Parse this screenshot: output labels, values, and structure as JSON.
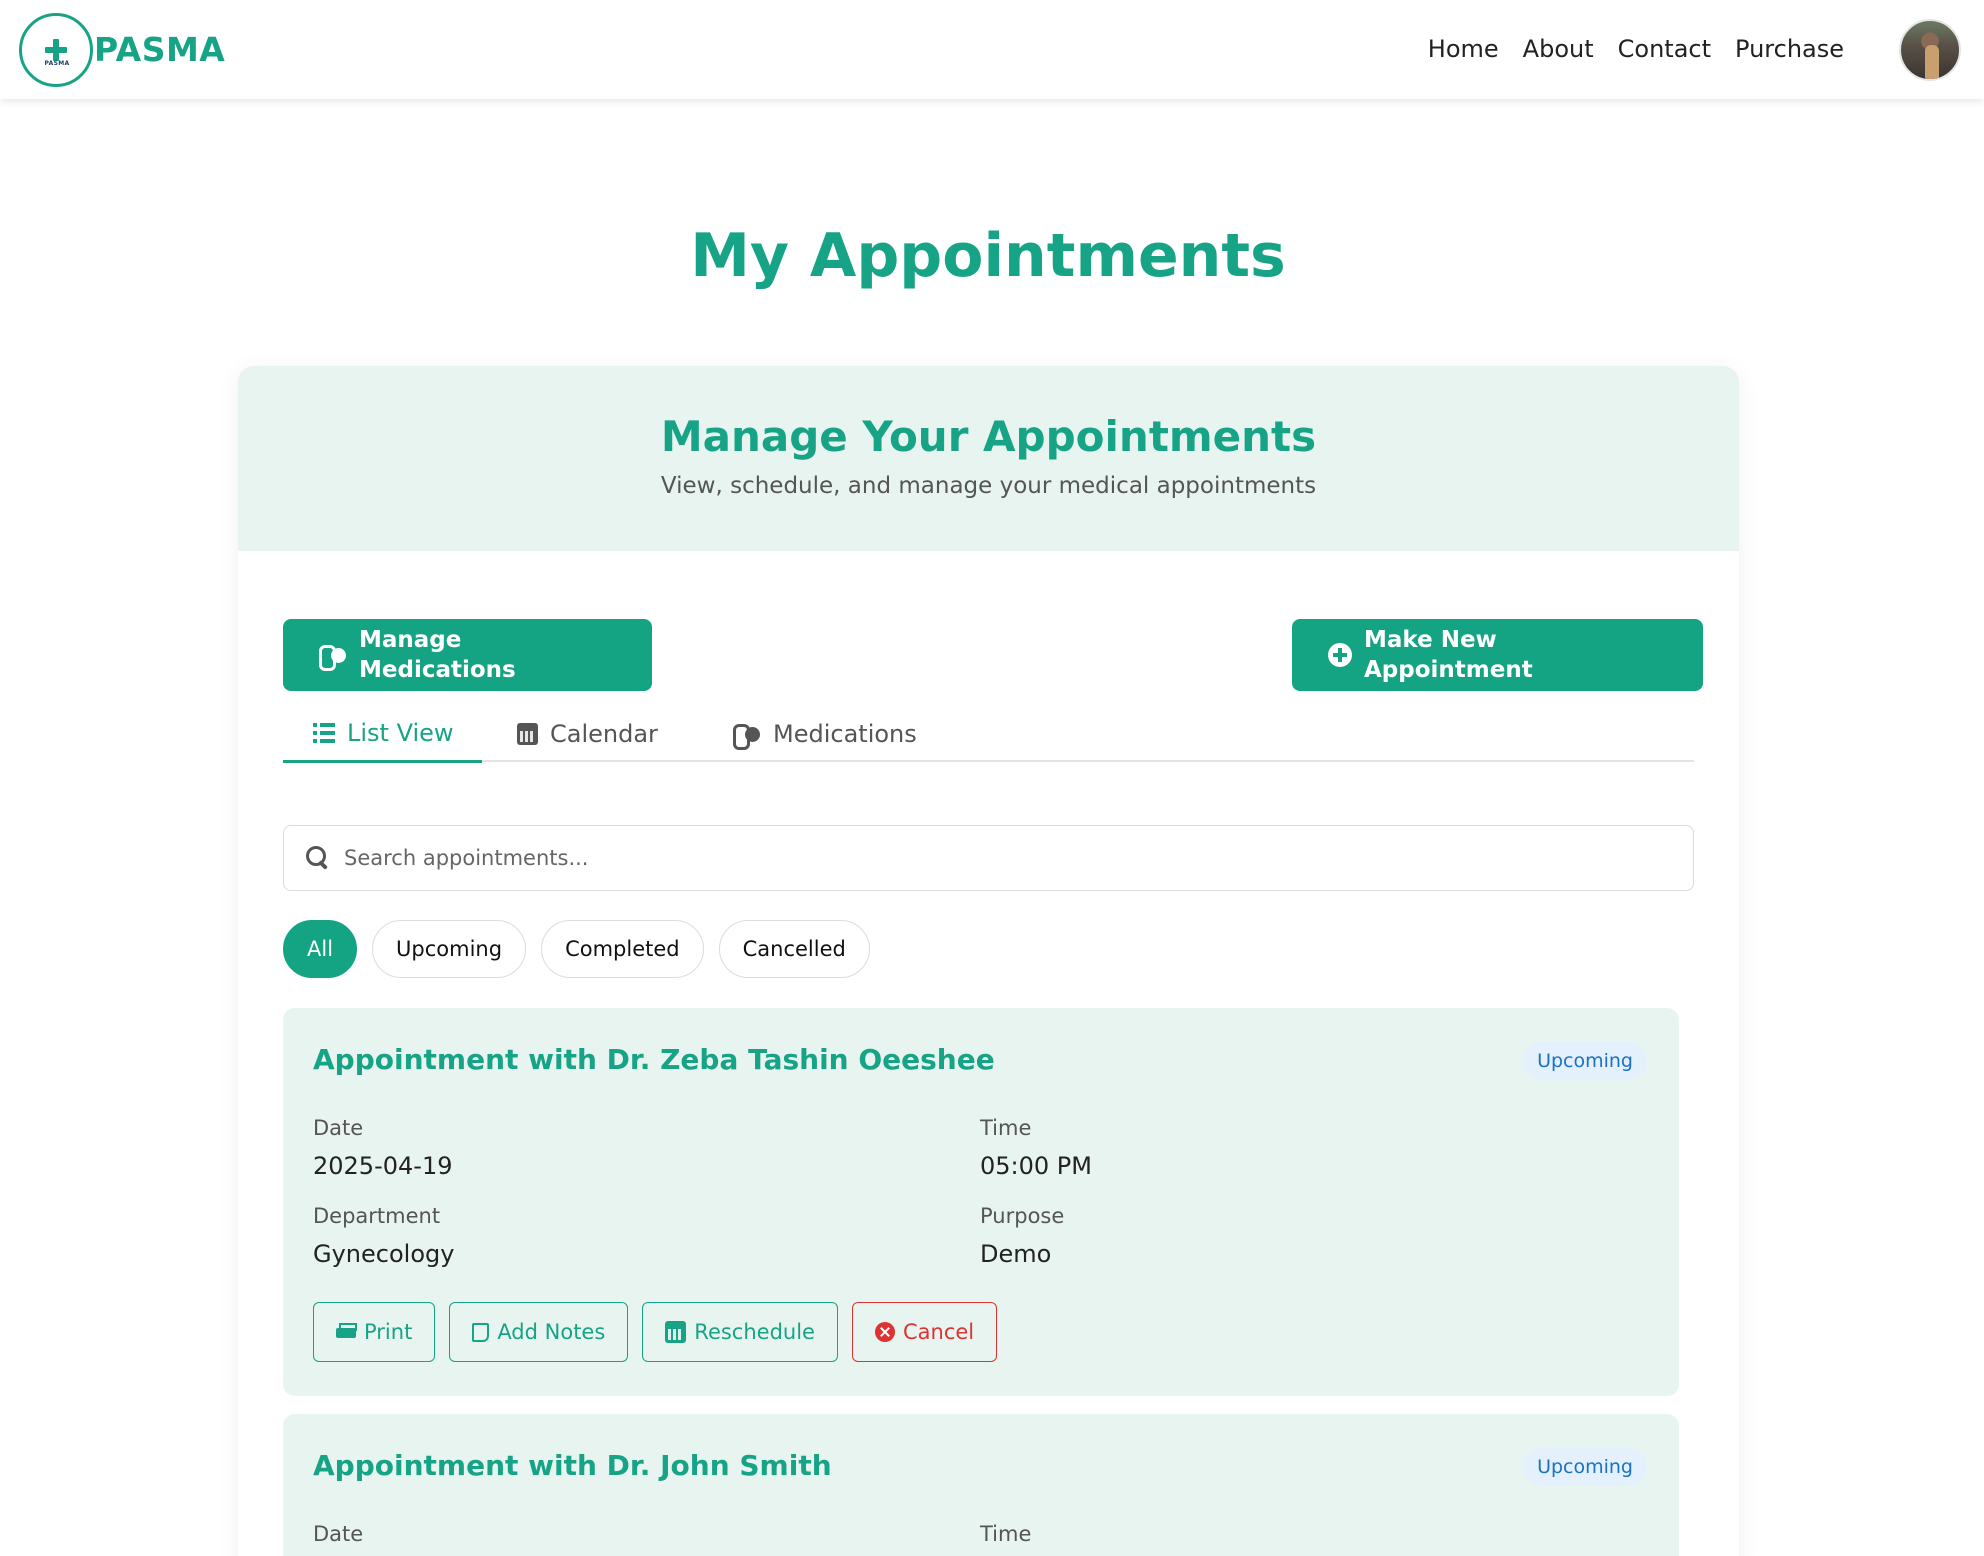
{
  "nav": {
    "brand": "PASMA",
    "logo_caption": "PASMA",
    "links": [
      "Home",
      "About",
      "Contact",
      "Purchase"
    ]
  },
  "page": {
    "title": "My Appointments"
  },
  "panel": {
    "title": "Manage Your Appointments",
    "subtitle": "View, schedule, and manage your medical appointments",
    "manage_medications_label": "Manage Medications",
    "new_appointment_label": "Make New Appointment"
  },
  "tabs": [
    {
      "label": "List View",
      "icon": "list-icon",
      "active": true
    },
    {
      "label": "Calendar",
      "icon": "calendar-icon",
      "active": false
    },
    {
      "label": "Medications",
      "icon": "pills-icon",
      "active": false
    }
  ],
  "search": {
    "placeholder": "Search appointments..."
  },
  "filters": [
    {
      "label": "All",
      "active": true
    },
    {
      "label": "Upcoming",
      "active": false
    },
    {
      "label": "Completed",
      "active": false
    },
    {
      "label": "Cancelled",
      "active": false
    }
  ],
  "appointments": [
    {
      "title": "Appointment with Dr. Zeba Tashin Oeeshee",
      "status": "Upcoming",
      "date_label": "Date",
      "date": "2025-04-19",
      "time_label": "Time",
      "time": "05:00 PM",
      "department_label": "Department",
      "department": "Gynecology",
      "purpose_label": "Purpose",
      "purpose": "Demo",
      "actions": [
        "Print",
        "Add Notes",
        "Reschedule",
        "Cancel"
      ]
    },
    {
      "title": "Appointment with Dr. John Smith",
      "status": "Upcoming",
      "date_label": "Date",
      "time_label": "Time"
    }
  ],
  "colors": {
    "brand": "#17a386",
    "panel_bg": "#e8f4f0",
    "badge_bg": "#e4f0fb",
    "badge_text": "#1a72c4",
    "cancel": "#dd3333"
  }
}
